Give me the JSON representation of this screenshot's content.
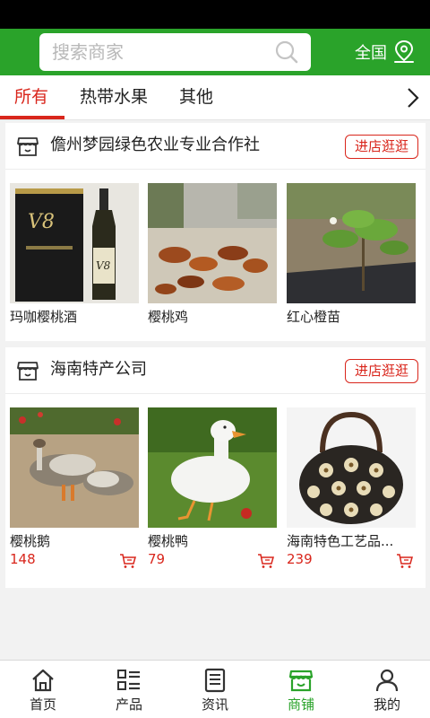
{
  "search": {
    "placeholder": "搜索商家"
  },
  "region": {
    "label": "全国"
  },
  "tabs": [
    {
      "label": "所有",
      "active": true
    },
    {
      "label": "热带水果",
      "active": false
    },
    {
      "label": "其他",
      "active": false
    }
  ],
  "stores": [
    {
      "name": "儋州梦园绿色农业专业合作社",
      "visit_label": "进店逛逛",
      "products": [
        {
          "name": "玛咖樱桃酒",
          "price": ""
        },
        {
          "name": "樱桃鸡",
          "price": ""
        },
        {
          "name": "红心橙苗",
          "price": ""
        }
      ]
    },
    {
      "name": "海南特产公司",
      "visit_label": "进店逛逛",
      "products": [
        {
          "name": "樱桃鹅",
          "price": "148"
        },
        {
          "name": "樱桃鸭",
          "price": "79"
        },
        {
          "name": "海南特色工艺品...",
          "price": "239"
        }
      ]
    }
  ],
  "bottom_nav": [
    {
      "label": "首页",
      "icon": "home-icon",
      "active": false
    },
    {
      "label": "产品",
      "icon": "product-list-icon",
      "active": false
    },
    {
      "label": "资讯",
      "icon": "news-icon",
      "active": false
    },
    {
      "label": "商铺",
      "icon": "shop-icon",
      "active": true
    },
    {
      "label": "我的",
      "icon": "user-icon",
      "active": false
    }
  ],
  "colors": {
    "brand_green": "#2aa32a",
    "accent_red": "#d9261c"
  }
}
